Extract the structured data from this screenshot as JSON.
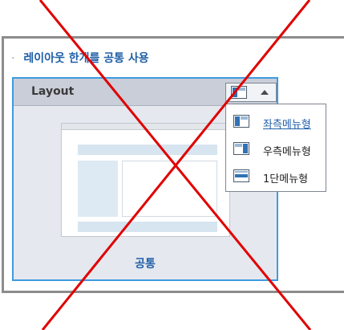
{
  "section": {
    "bullet": "·",
    "title": "레이아웃 한개를 공통 사용"
  },
  "card": {
    "title": "Layout",
    "caption": "공통"
  },
  "dropdown": {
    "items": [
      {
        "label": "좌측메뉴형",
        "icon": "left-menu-layout-icon",
        "selected": true
      },
      {
        "label": "우측메뉴형",
        "icon": "right-menu-layout-icon",
        "selected": false
      },
      {
        "label": "1단메뉴형",
        "icon": "single-column-layout-icon",
        "selected": false
      }
    ]
  },
  "colors": {
    "accent": "#1f5fa8",
    "card_border": "#3d9be0",
    "cross": "#e00000"
  }
}
